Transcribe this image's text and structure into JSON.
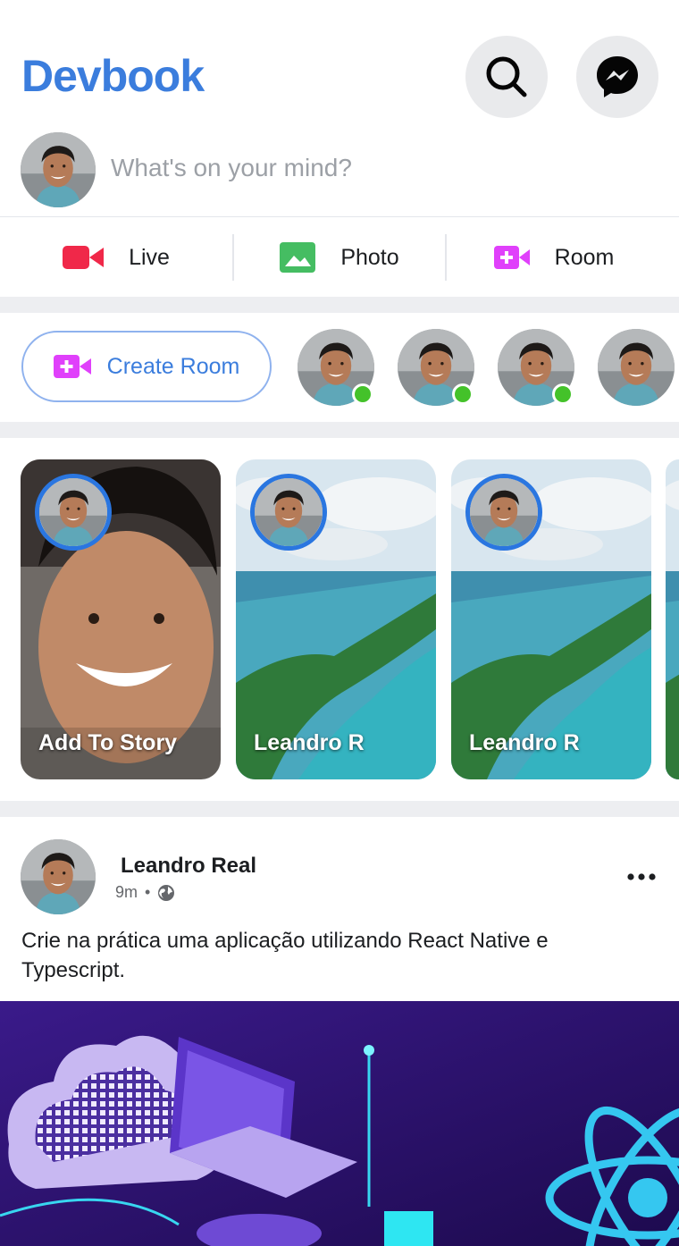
{
  "header": {
    "brand": "Devbook",
    "search_icon": "search-icon",
    "messenger_icon": "messenger-icon"
  },
  "composer": {
    "placeholder": "What's on your mind?"
  },
  "actions": [
    {
      "label": "Live",
      "icon": "video-icon",
      "color": "#f02849"
    },
    {
      "label": "Photo",
      "icon": "photo-icon",
      "color": "#45bd62"
    },
    {
      "label": "Room",
      "icon": "video-plus-icon",
      "color": "#e040fb"
    }
  ],
  "rooms": {
    "create_label": "Create Room",
    "create_icon": "video-plus-icon",
    "accent": "#3b7ddd",
    "online_color": "#44c22a"
  },
  "stories": [
    {
      "label": "Add To Story"
    },
    {
      "label": "Leandro R"
    },
    {
      "label": "Leandro R"
    }
  ],
  "post": {
    "author": "Leandro Real",
    "time": "9m",
    "separator": "•",
    "privacy_icon": "globe-icon",
    "text": "Crie na prática uma aplicação utilizando React Native e Typescript.",
    "more_icon": "more-dots-icon"
  }
}
